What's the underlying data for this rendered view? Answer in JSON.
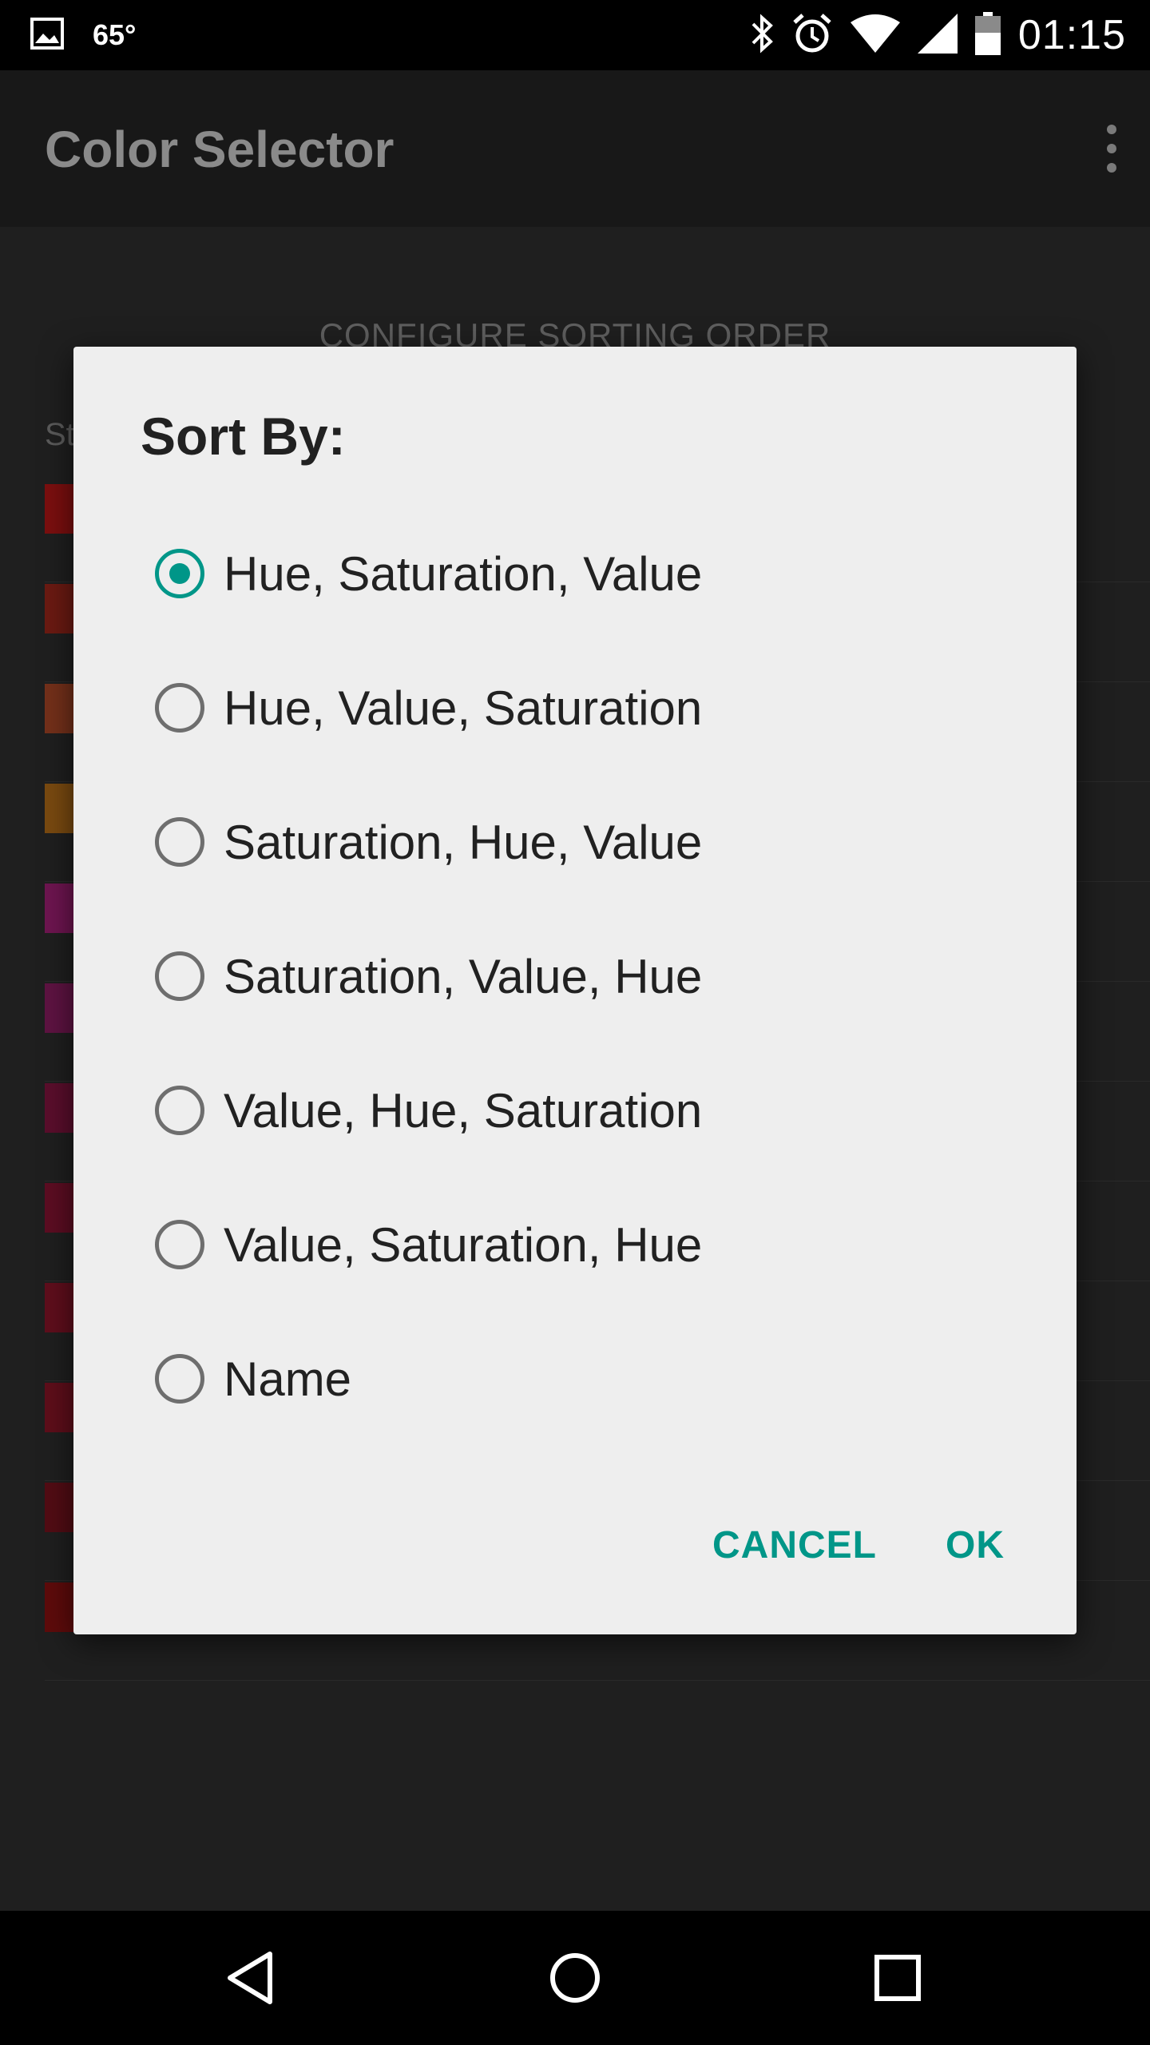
{
  "status_bar": {
    "temperature": "65°",
    "time": "01:15",
    "icons": [
      "image-icon",
      "bluetooth-icon",
      "alarm-icon",
      "wifi-icon",
      "cell-signal-icon",
      "battery-icon"
    ]
  },
  "app_bar": {
    "title": "Color Selector",
    "menu_icon": "more-vert-icon"
  },
  "background": {
    "configure_button": "CONFIGURE SORTING ORDER",
    "section_label": "St",
    "swatch_colors": [
      "#7b0f0f",
      "#6b1a12",
      "#74301a",
      "#7a4a10",
      "#6e1550",
      "#5e1342",
      "#5a0e2c",
      "#5c0d22",
      "#5f0e1c",
      "#5e0e1a",
      "#520c14",
      "#5e0b0b"
    ]
  },
  "dialog": {
    "title": "Sort By:",
    "options": [
      {
        "label": "Hue, Saturation, Value"
      },
      {
        "label": "Hue, Value, Saturation"
      },
      {
        "label": "Saturation, Hue, Value"
      },
      {
        "label": "Saturation, Value, Hue"
      },
      {
        "label": "Value, Hue, Saturation"
      },
      {
        "label": "Value, Saturation, Hue"
      },
      {
        "label": "Name"
      }
    ],
    "selected_index": 0,
    "cancel_label": "CANCEL",
    "ok_label": "OK",
    "accent_color": "#009688"
  },
  "nav_bar": {
    "icons": [
      "back-icon",
      "home-icon",
      "recents-icon"
    ]
  }
}
